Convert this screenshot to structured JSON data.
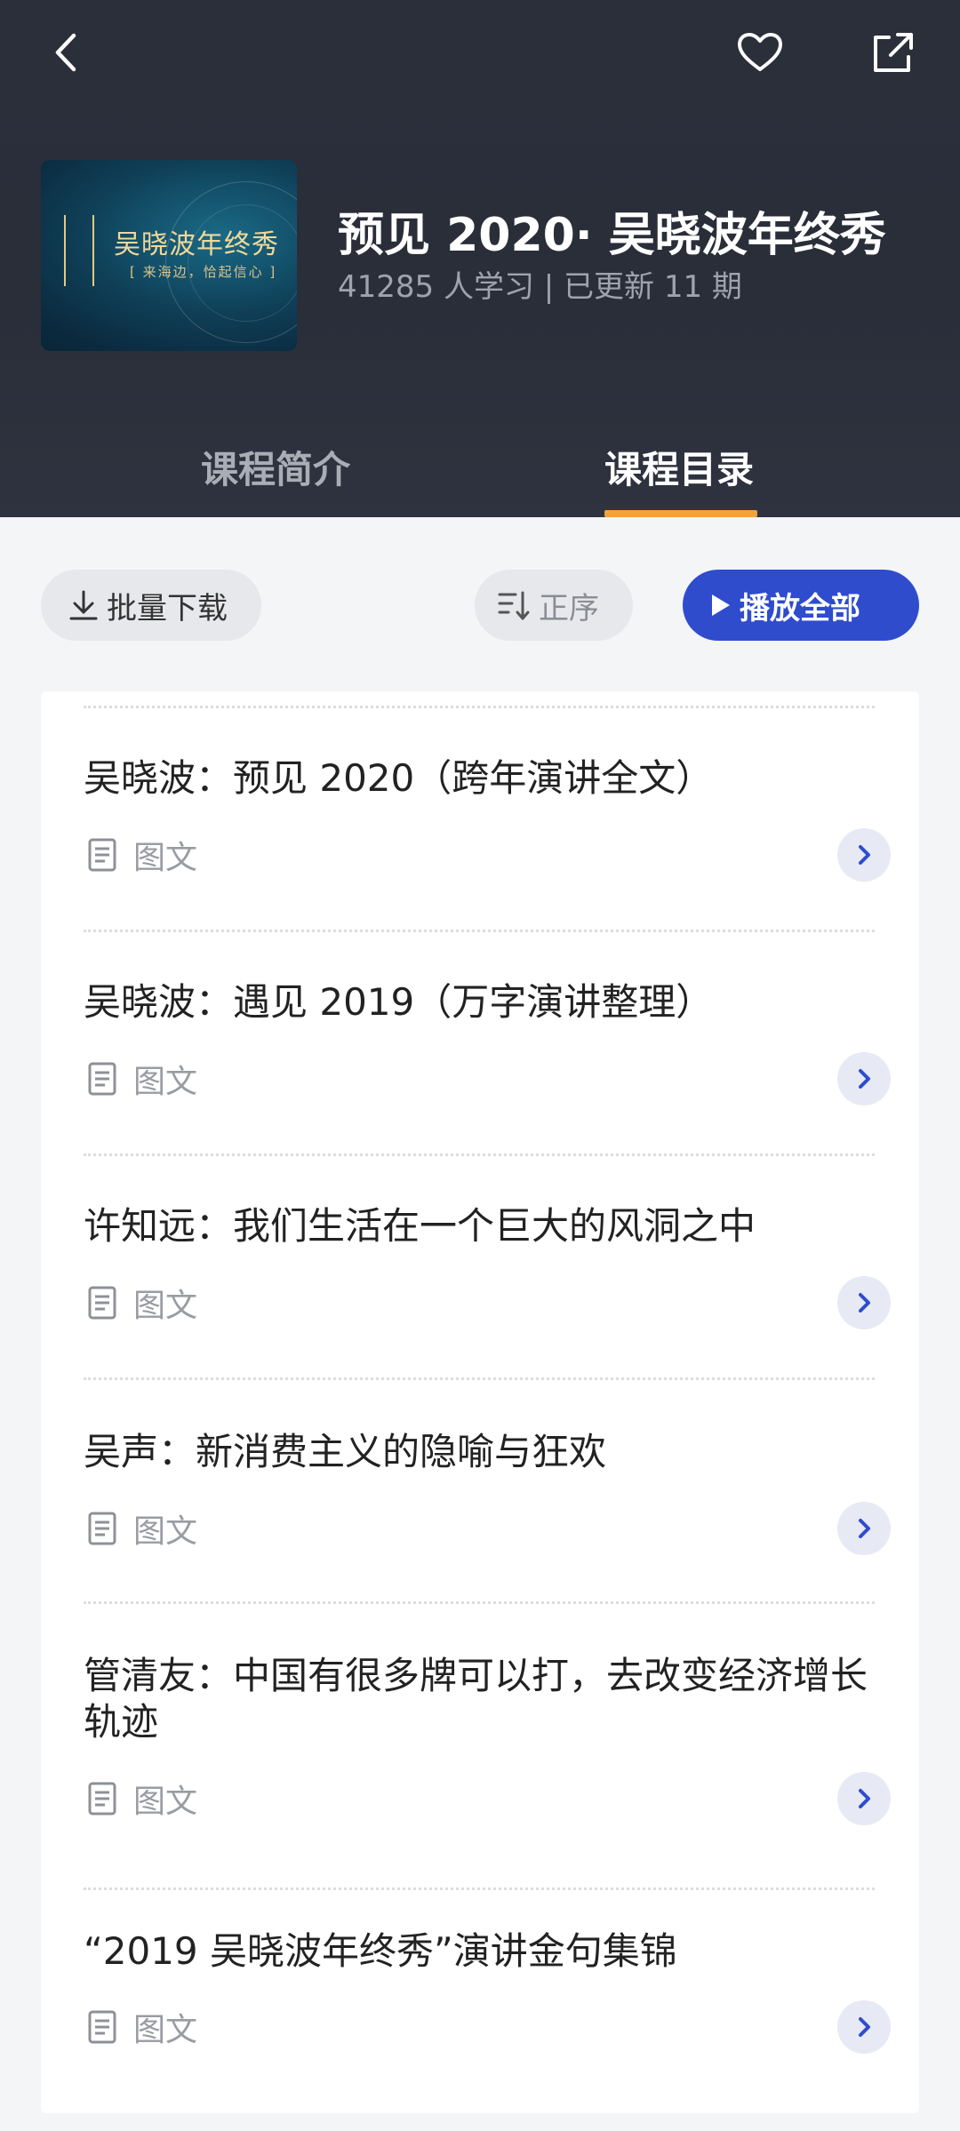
{
  "header": {
    "course_title": "预见 2020· 吴晓波年终秀",
    "course_meta": "41285 人学习 | 已更新 11 期",
    "cover": {
      "title": "吴晓波年终秀",
      "subtitle": "[ 来海边，恰起信心 ]"
    },
    "icons": {
      "back": "chevron-left-icon",
      "favorite": "heart-icon",
      "share": "share-icon"
    }
  },
  "tabs": [
    {
      "label": "课程简介",
      "active": false
    },
    {
      "label": "课程目录",
      "active": true
    }
  ],
  "toolbar": {
    "download_label": "批量下载",
    "sort_label": "正序",
    "play_all_label": "播放全部"
  },
  "colors": {
    "header_bg": "#2b2f3a",
    "accent_underline": "#f0a23b",
    "play_button": "#2f4ccd",
    "arrow_bg": "#e7e9f4",
    "arrow_fg": "#2f4ccd"
  },
  "items": [
    {
      "title": "吴晓波：预见 2020（跨年演讲全文）",
      "type": "图文"
    },
    {
      "title": "吴晓波：遇见 2019（万字演讲整理）",
      "type": "图文"
    },
    {
      "title": "许知远：我们生活在一个巨大的风洞之中",
      "type": "图文"
    },
    {
      "title": "吴声：新消费主义的隐喻与狂欢",
      "type": "图文"
    },
    {
      "title": "管清友：中国有很多牌可以打，去改变经济增长轨迹",
      "type": "图文"
    },
    {
      "title": "“2019 吴晓波年终秀”演讲金句集锦",
      "type": "图文"
    }
  ]
}
